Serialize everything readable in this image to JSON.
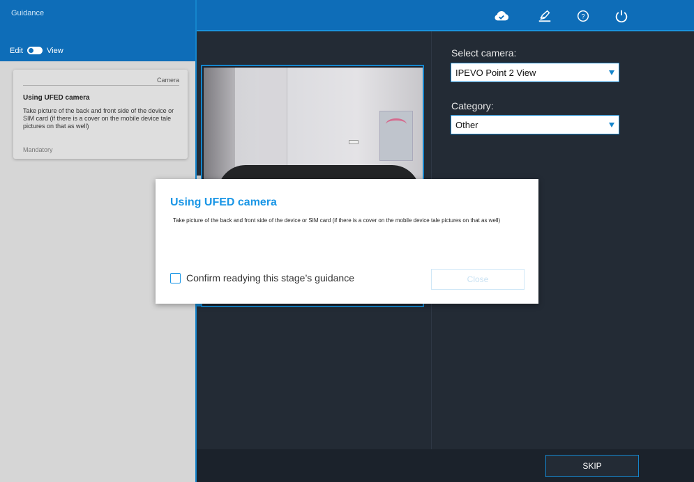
{
  "sidebar": {
    "title": "Guidance",
    "mode": {
      "edit_label": "Edit",
      "view_label": "View",
      "state": "view"
    },
    "card": {
      "category": "Camera",
      "title": "Using UFED camera",
      "description": "Take picture of the back and front side of the device or SIM card (if there is a cover on the mobile device tale pictures on that as well)",
      "tag": "Mandatory"
    }
  },
  "toolbar": {
    "icons": [
      "cloud-check-icon",
      "sign-icon",
      "help-icon",
      "power-icon"
    ]
  },
  "camera_panel": {
    "select_camera_label": "Select camera:",
    "select_camera_value": "IPEVO Point 2 View",
    "category_label": "Category:",
    "category_value": "Other"
  },
  "footer": {
    "skip_label": "SKIP"
  },
  "modal": {
    "title": "Using UFED camera",
    "description": "Take picture of the back and front side of the device or SIM card (if there is a cover on the mobile device tale pictures on that as well)",
    "confirm_label": "Confirm readying this stage’s guidance",
    "confirm_checked": false,
    "close_label": "Close",
    "close_enabled": false
  },
  "colors": {
    "brand_blue": "#0e6db8",
    "accent_blue": "#1a96e6",
    "dark_bg": "#232b35"
  }
}
